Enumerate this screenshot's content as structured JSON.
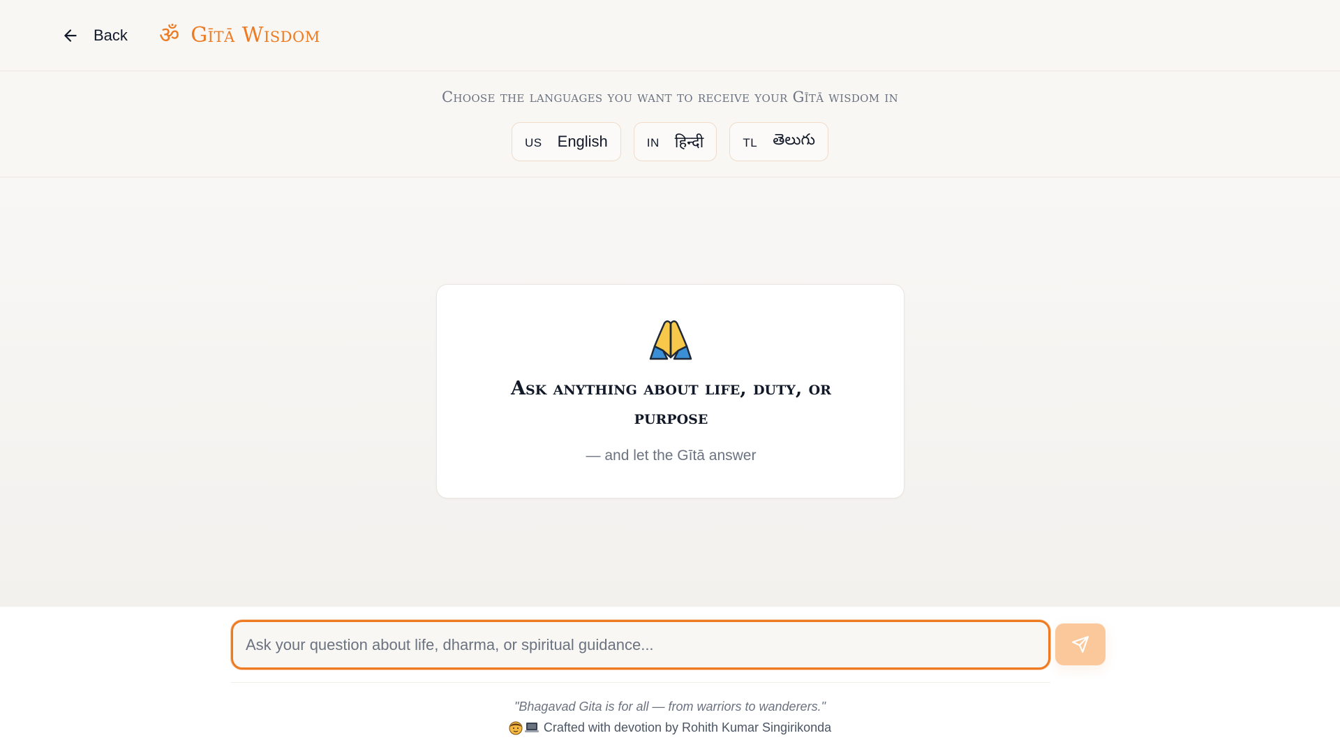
{
  "header": {
    "back_label": "Back",
    "brand_icon": "om-icon",
    "brand_symbol": "ॐ",
    "brand_title": "Gītā Wisdom",
    "accent_color": "#ee7a22"
  },
  "language_section": {
    "heading": "Choose the languages you want to receive your Gītā wisdom in",
    "options": [
      {
        "code": "US",
        "name": "English"
      },
      {
        "code": "IN",
        "name": "हिन्दी"
      },
      {
        "code": "TL",
        "name": "తెలుగు"
      }
    ]
  },
  "welcome": {
    "icon": "folded-hands-icon",
    "title": "Ask anything about life, duty, or purpose",
    "subtitle": "— and let the Gītā answer"
  },
  "composer": {
    "placeholder": "Ask your question about life, dharma, or spiritual guidance...",
    "value": "",
    "send_icon": "send-icon",
    "send_button_color": "#fbc89c"
  },
  "footer": {
    "quote": "\"Bhagavad Gita is for all — from warriors to wanderers.\"",
    "credit_icons": [
      "person-icon",
      "laptop-icon"
    ],
    "credit_text": "Crafted with devotion by Rohith Kumar Singirikonda"
  }
}
